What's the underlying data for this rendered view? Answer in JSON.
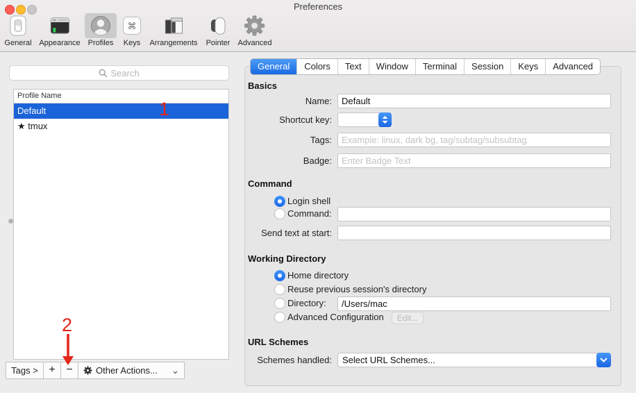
{
  "window": {
    "title": "Preferences"
  },
  "toolbar": {
    "selected": "Profiles",
    "items": [
      {
        "label": "General"
      },
      {
        "label": "Appearance"
      },
      {
        "label": "Profiles"
      },
      {
        "label": "Keys"
      },
      {
        "label": "Arrangements"
      },
      {
        "label": "Pointer"
      },
      {
        "label": "Advanced"
      }
    ]
  },
  "icons": {
    "command_glyph": "⌘"
  },
  "sidebar": {
    "search_placeholder": "Search",
    "list_header": "Profile Name",
    "profiles": [
      {
        "name": "Default",
        "selected": true
      },
      {
        "name": "★ tmux",
        "selected": false
      }
    ],
    "buttons": {
      "tags": "Tags >",
      "add": "+",
      "remove": "−",
      "other_actions": "Other Actions...",
      "chevron": "⌄"
    }
  },
  "annotations": {
    "one": "1",
    "two": "2",
    "color": "#e42518"
  },
  "tabs": {
    "selected_index": 0,
    "items": [
      "General",
      "Colors",
      "Text",
      "Window",
      "Terminal",
      "Session",
      "Keys",
      "Advanced"
    ]
  },
  "panel": {
    "basics": {
      "heading": "Basics",
      "name_label": "Name:",
      "name_value": "Default",
      "shortcut_label": "Shortcut key:",
      "tags_label": "Tags:",
      "tags_placeholder": "Example: linux, dark bg, tag/subtag/subsubtag",
      "badge_label": "Badge:",
      "badge_placeholder": "Enter Badge Text"
    },
    "command": {
      "heading": "Command",
      "login_shell_label": "Login shell",
      "login_shell_selected": true,
      "command_label": "Command:",
      "command_selected": false,
      "send_text_label": "Send text at start:"
    },
    "working_directory": {
      "heading": "Working Directory",
      "home_label": "Home directory",
      "home_selected": true,
      "reuse_label": "Reuse previous session's directory",
      "directory_label": "Directory:",
      "directory_value": "/Users/mac",
      "advanced_label": "Advanced Configuration",
      "edit_button": "Edit..."
    },
    "url_schemes": {
      "heading": "URL Schemes",
      "label": "Schemes handled:",
      "value": "Select URL Schemes..."
    }
  },
  "colors": {
    "selection_blue": "#1b63d8",
    "tab_selected_blue": "#1a6ae3",
    "annotation_red": "#e42518",
    "traffic_close": "#ff5f57",
    "traffic_minimize": "#fdbc2e",
    "traffic_zoom_disabled": "#c9c7c5"
  }
}
